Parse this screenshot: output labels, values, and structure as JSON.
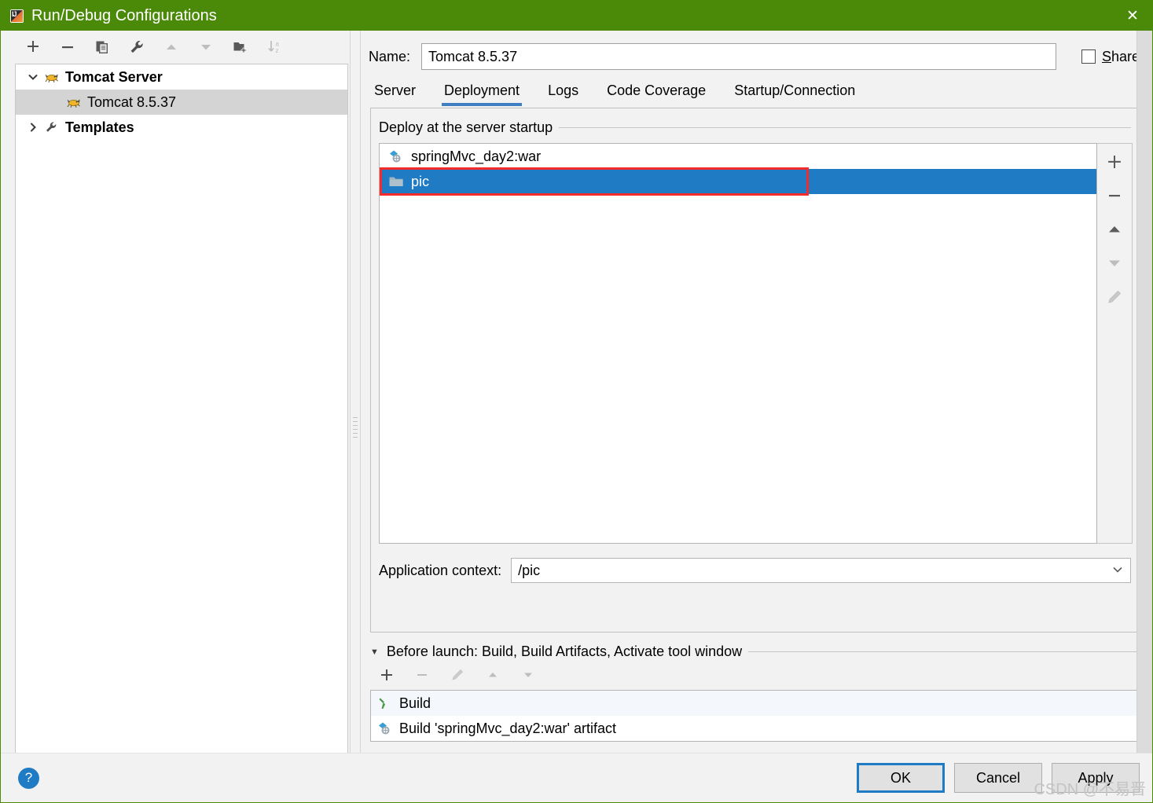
{
  "window": {
    "title": "Run/Debug Configurations",
    "title_icon": "intellij-idea-icon",
    "close_label": "✕",
    "titlebar_color": "#4b8a09"
  },
  "left_toolbar": {
    "buttons": [
      {
        "name": "add-configuration-button",
        "icon": "plus-icon",
        "enabled": true
      },
      {
        "name": "remove-configuration-button",
        "icon": "minus-icon",
        "enabled": true
      },
      {
        "name": "copy-configuration-button",
        "icon": "copy-icon",
        "enabled": true
      },
      {
        "name": "edit-templates-button",
        "icon": "wrench-icon",
        "enabled": true
      },
      {
        "name": "move-up-button",
        "icon": "triangle-up-icon",
        "enabled": false
      },
      {
        "name": "move-down-button",
        "icon": "triangle-down-icon",
        "enabled": false
      },
      {
        "name": "new-folder-button",
        "icon": "folder-add-icon",
        "enabled": true
      },
      {
        "name": "sort-alphabetically-button",
        "icon": "sort-az-icon",
        "enabled": false
      }
    ]
  },
  "tree": {
    "nodes": [
      {
        "label": "Tomcat Server",
        "icon": "tomcat-icon",
        "twisty": "⌄",
        "expanded": true,
        "bold": true,
        "child": false,
        "selected": false
      },
      {
        "label": "Tomcat 8.5.37",
        "icon": "tomcat-icon",
        "twisty": "",
        "expanded": false,
        "bold": false,
        "child": true,
        "selected": true
      },
      {
        "label": "Templates",
        "icon": "wrench-icon",
        "twisty": "›",
        "expanded": false,
        "bold": true,
        "child": false,
        "selected": false
      }
    ]
  },
  "name_field": {
    "label": "Name:",
    "value": "Tomcat 8.5.37",
    "placeholder": ""
  },
  "share": {
    "label_prefix": "",
    "label_mnemonic": "S",
    "label_rest": "hare",
    "checked": false
  },
  "tabs": [
    {
      "label": "Server",
      "active": false
    },
    {
      "label": "Deployment",
      "active": true
    },
    {
      "label": "Logs",
      "active": false
    },
    {
      "label": "Code Coverage",
      "active": false
    },
    {
      "label": "Startup/Connection",
      "active": false
    }
  ],
  "deployment": {
    "group_title": "Deploy at the server startup",
    "items": [
      {
        "label": "springMvc_day2:war",
        "icon": "artifact-icon",
        "selected": false,
        "highlighted": false
      },
      {
        "label": "pic",
        "icon": "folder-icon",
        "selected": true,
        "highlighted": true
      }
    ],
    "side_buttons": [
      {
        "name": "add-artifact-button",
        "icon": "plus-icon",
        "enabled": true
      },
      {
        "name": "remove-artifact-button",
        "icon": "minus-icon",
        "enabled": true
      },
      {
        "name": "move-artifact-up-button",
        "icon": "triangle-up-icon",
        "enabled": true
      },
      {
        "name": "move-artifact-down-button",
        "icon": "triangle-down-icon",
        "enabled": false
      },
      {
        "name": "edit-artifact-button",
        "icon": "pencil-icon",
        "enabled": false
      }
    ],
    "application_context": {
      "label": "Application context:",
      "value": "/pic",
      "arrow": "⌄"
    },
    "highlight_color": "#f52a2a",
    "selection_color": "#1f7bc4"
  },
  "before_launch": {
    "arrow": "▼",
    "title": "Before launch: Build, Build Artifacts, Activate tool window",
    "toolbar": [
      {
        "name": "add-task-button",
        "icon": "plus-icon",
        "enabled": true
      },
      {
        "name": "remove-task-button",
        "icon": "minus-icon",
        "enabled": false
      },
      {
        "name": "edit-task-button",
        "icon": "pencil-icon",
        "enabled": false
      },
      {
        "name": "move-task-up-button",
        "icon": "triangle-up-icon",
        "enabled": false
      },
      {
        "name": "move-task-down-button",
        "icon": "triangle-down-icon",
        "enabled": false
      }
    ],
    "items": [
      {
        "label": "Build",
        "icon": "build-hammer-icon"
      },
      {
        "label": "Build 'springMvc_day2:war' artifact",
        "icon": "artifact-icon"
      }
    ]
  },
  "footer": {
    "help_label": "?",
    "buttons": [
      {
        "label": "OK",
        "name": "ok-button",
        "primary": true
      },
      {
        "label": "Cancel",
        "name": "cancel-button",
        "primary": false
      },
      {
        "label": "Apply",
        "name": "apply-button",
        "primary": false
      }
    ]
  },
  "watermark": {
    "text": "CSDN @不易晋"
  }
}
